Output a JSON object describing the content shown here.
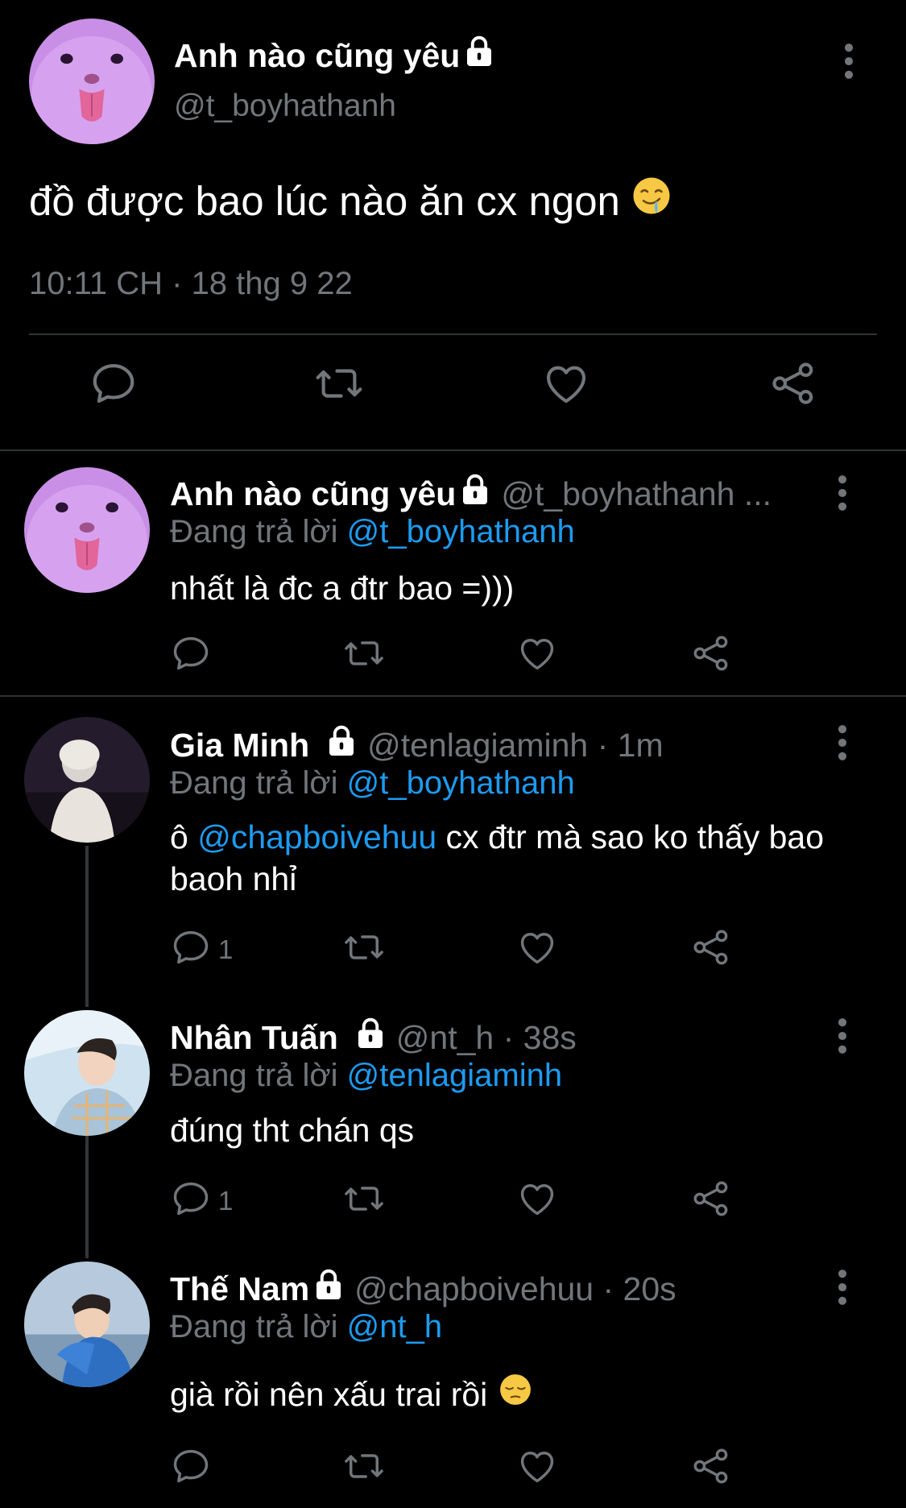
{
  "main_tweet": {
    "name": "Anh nào cũng yêu",
    "handle": "@t_boyhathanh",
    "text": "đồ được bao lúc nào ăn cx ngon",
    "emoji_icon": "drooling-face-icon",
    "timestamp": "10:11 CH · 18 thg 9 22"
  },
  "replies": [
    {
      "name": "Anh nào cũng yêu",
      "handle": "@t_boyhathanh ...",
      "replying_label": "Đang trả lời",
      "replying_to": "@t_boyhathanh",
      "text": "nhất là đc a đtr bao =)))",
      "reply_count": ""
    },
    {
      "name": "Gia Minh",
      "handle": "@tenlagiaminh · 1m",
      "replying_label": "Đang trả lời",
      "replying_to": "@t_boyhathanh",
      "text_pre": "ô ",
      "text_mention": "@chapboivehuu",
      "text_post": " cx đtr mà sao ko thấy bao baoh nhỉ",
      "reply_count": "1"
    },
    {
      "name": "Nhân Tuấn",
      "handle": "@nt_h · 38s",
      "replying_label": "Đang trả lời",
      "replying_to": "@tenlagiaminh",
      "text": "đúng tht chán qs",
      "reply_count": "1"
    },
    {
      "name": "Thế Nam",
      "handle": "@chapboivehuu · 20s",
      "replying_label": "Đang trả lời",
      "replying_to": "@nt_h",
      "text": "già rồi nên xấu trai rồi",
      "emoji_icon": "pensive-face-icon",
      "reply_count": ""
    }
  ],
  "colors": {
    "background": "#000000",
    "text": "#ffffff",
    "secondary": "#71767b",
    "link": "#1d9bf0",
    "divider": "#2f3336"
  }
}
